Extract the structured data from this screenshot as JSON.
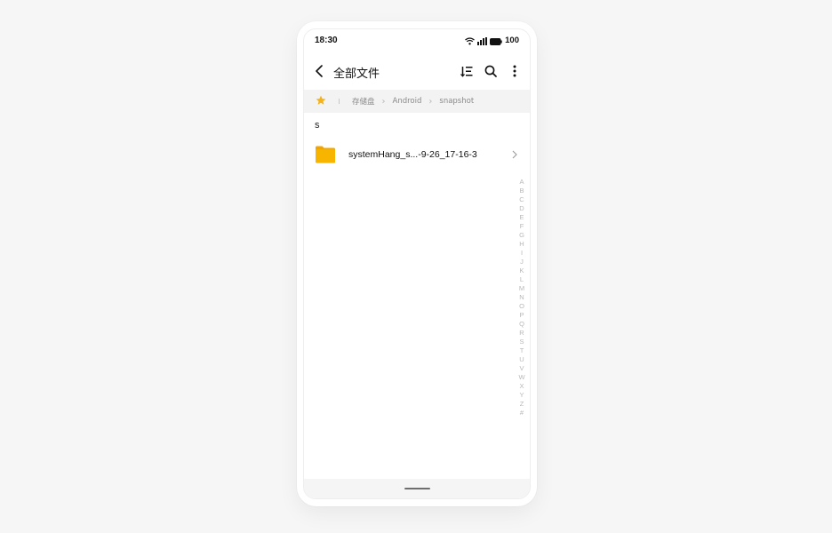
{
  "status_bar": {
    "time": "18:30",
    "battery": "100",
    "icons": [
      "wifi-icon",
      "signal-icon",
      "battery-icon"
    ]
  },
  "header": {
    "title": "全部文件",
    "back_icon": "back-arrow-icon",
    "actions": [
      "sort-icon",
      "search-icon",
      "more-vert-icon"
    ]
  },
  "breadcrumb": {
    "favorite_icon": "star-icon",
    "items": [
      "存储盘",
      "Android",
      "snapshot"
    ]
  },
  "section": {
    "letter": "s"
  },
  "files": [
    {
      "name": "systemHang_s...-9-26_17-16-3",
      "icon": "folder-icon"
    }
  ],
  "alpha_index": [
    "A",
    "B",
    "C",
    "D",
    "E",
    "F",
    "G",
    "H",
    "I",
    "J",
    "K",
    "L",
    "M",
    "N",
    "O",
    "P",
    "Q",
    "R",
    "S",
    "T",
    "U",
    "V",
    "W",
    "X",
    "Y",
    "Z",
    "#"
  ],
  "colors": {
    "accent_star": "#f5b31b",
    "folder": "#f7b500",
    "breadcrumb_bg": "#f3f3f3"
  }
}
